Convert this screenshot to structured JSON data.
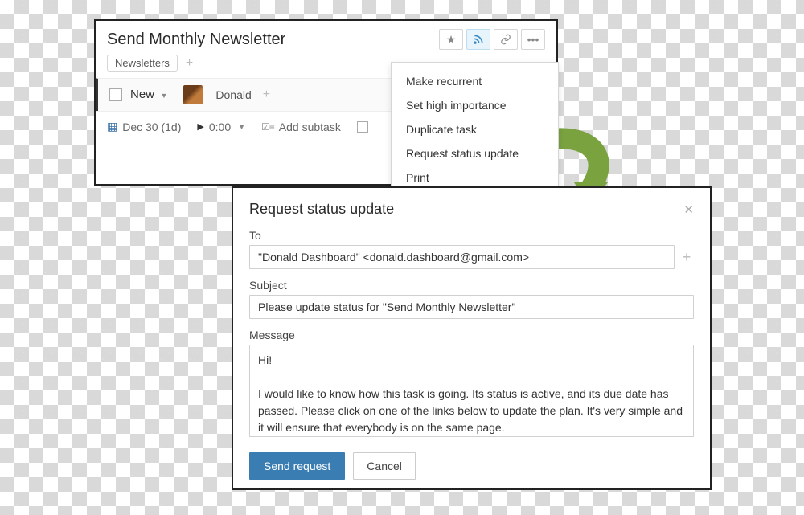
{
  "task": {
    "title": "Send Monthly Newsletter",
    "tag": "Newsletters",
    "status": "New",
    "assignee": "Donald",
    "due": "Dec 30 (1d)",
    "duration": "0:00",
    "add_subtask": "Add subtask",
    "progress_field_visible": true
  },
  "menu": {
    "items": [
      "Make recurrent",
      "Set high importance",
      "Duplicate task",
      "Request status update",
      "Print"
    ]
  },
  "modal": {
    "title": "Request status update",
    "to_label": "To",
    "to_value": "\"Donald Dashboard\" <donald.dashboard@gmail.com>",
    "subject_label": "Subject",
    "subject_value": "Please update status for \"Send Monthly Newsletter\"",
    "message_label": "Message",
    "message_value": "Hi!\n\nI would like to know how this task is going. Its status is active, and its due date has passed. Please click on one of the links below to update the plan. It's very simple and it will ensure that everybody is on the same page.",
    "send_label": "Send request",
    "cancel_label": "Cancel"
  }
}
